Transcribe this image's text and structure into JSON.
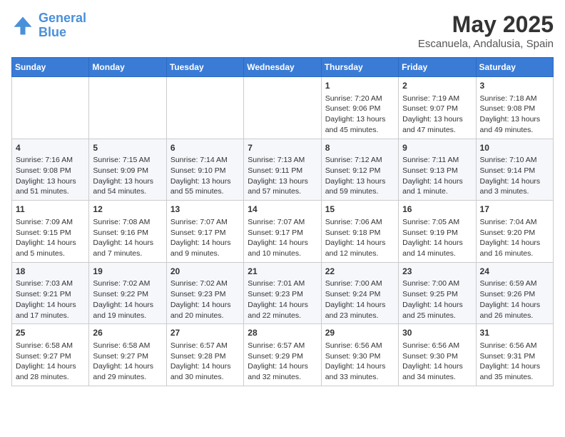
{
  "header": {
    "logo_line1": "General",
    "logo_line2": "Blue",
    "month": "May 2025",
    "location": "Escanuela, Andalusia, Spain"
  },
  "days_of_week": [
    "Sunday",
    "Monday",
    "Tuesday",
    "Wednesday",
    "Thursday",
    "Friday",
    "Saturday"
  ],
  "weeks": [
    [
      {
        "day": "",
        "content": ""
      },
      {
        "day": "",
        "content": ""
      },
      {
        "day": "",
        "content": ""
      },
      {
        "day": "",
        "content": ""
      },
      {
        "day": "1",
        "content": "Sunrise: 7:20 AM\nSunset: 9:06 PM\nDaylight: 13 hours\nand 45 minutes."
      },
      {
        "day": "2",
        "content": "Sunrise: 7:19 AM\nSunset: 9:07 PM\nDaylight: 13 hours\nand 47 minutes."
      },
      {
        "day": "3",
        "content": "Sunrise: 7:18 AM\nSunset: 9:08 PM\nDaylight: 13 hours\nand 49 minutes."
      }
    ],
    [
      {
        "day": "4",
        "content": "Sunrise: 7:16 AM\nSunset: 9:08 PM\nDaylight: 13 hours\nand 51 minutes."
      },
      {
        "day": "5",
        "content": "Sunrise: 7:15 AM\nSunset: 9:09 PM\nDaylight: 13 hours\nand 54 minutes."
      },
      {
        "day": "6",
        "content": "Sunrise: 7:14 AM\nSunset: 9:10 PM\nDaylight: 13 hours\nand 55 minutes."
      },
      {
        "day": "7",
        "content": "Sunrise: 7:13 AM\nSunset: 9:11 PM\nDaylight: 13 hours\nand 57 minutes."
      },
      {
        "day": "8",
        "content": "Sunrise: 7:12 AM\nSunset: 9:12 PM\nDaylight: 13 hours\nand 59 minutes."
      },
      {
        "day": "9",
        "content": "Sunrise: 7:11 AM\nSunset: 9:13 PM\nDaylight: 14 hours\nand 1 minute."
      },
      {
        "day": "10",
        "content": "Sunrise: 7:10 AM\nSunset: 9:14 PM\nDaylight: 14 hours\nand 3 minutes."
      }
    ],
    [
      {
        "day": "11",
        "content": "Sunrise: 7:09 AM\nSunset: 9:15 PM\nDaylight: 14 hours\nand 5 minutes."
      },
      {
        "day": "12",
        "content": "Sunrise: 7:08 AM\nSunset: 9:16 PM\nDaylight: 14 hours\nand 7 minutes."
      },
      {
        "day": "13",
        "content": "Sunrise: 7:07 AM\nSunset: 9:17 PM\nDaylight: 14 hours\nand 9 minutes."
      },
      {
        "day": "14",
        "content": "Sunrise: 7:07 AM\nSunset: 9:17 PM\nDaylight: 14 hours\nand 10 minutes."
      },
      {
        "day": "15",
        "content": "Sunrise: 7:06 AM\nSunset: 9:18 PM\nDaylight: 14 hours\nand 12 minutes."
      },
      {
        "day": "16",
        "content": "Sunrise: 7:05 AM\nSunset: 9:19 PM\nDaylight: 14 hours\nand 14 minutes."
      },
      {
        "day": "17",
        "content": "Sunrise: 7:04 AM\nSunset: 9:20 PM\nDaylight: 14 hours\nand 16 minutes."
      }
    ],
    [
      {
        "day": "18",
        "content": "Sunrise: 7:03 AM\nSunset: 9:21 PM\nDaylight: 14 hours\nand 17 minutes."
      },
      {
        "day": "19",
        "content": "Sunrise: 7:02 AM\nSunset: 9:22 PM\nDaylight: 14 hours\nand 19 minutes."
      },
      {
        "day": "20",
        "content": "Sunrise: 7:02 AM\nSunset: 9:23 PM\nDaylight: 14 hours\nand 20 minutes."
      },
      {
        "day": "21",
        "content": "Sunrise: 7:01 AM\nSunset: 9:23 PM\nDaylight: 14 hours\nand 22 minutes."
      },
      {
        "day": "22",
        "content": "Sunrise: 7:00 AM\nSunset: 9:24 PM\nDaylight: 14 hours\nand 23 minutes."
      },
      {
        "day": "23",
        "content": "Sunrise: 7:00 AM\nSunset: 9:25 PM\nDaylight: 14 hours\nand 25 minutes."
      },
      {
        "day": "24",
        "content": "Sunrise: 6:59 AM\nSunset: 9:26 PM\nDaylight: 14 hours\nand 26 minutes."
      }
    ],
    [
      {
        "day": "25",
        "content": "Sunrise: 6:58 AM\nSunset: 9:27 PM\nDaylight: 14 hours\nand 28 minutes."
      },
      {
        "day": "26",
        "content": "Sunrise: 6:58 AM\nSunset: 9:27 PM\nDaylight: 14 hours\nand 29 minutes."
      },
      {
        "day": "27",
        "content": "Sunrise: 6:57 AM\nSunset: 9:28 PM\nDaylight: 14 hours\nand 30 minutes."
      },
      {
        "day": "28",
        "content": "Sunrise: 6:57 AM\nSunset: 9:29 PM\nDaylight: 14 hours\nand 32 minutes."
      },
      {
        "day": "29",
        "content": "Sunrise: 6:56 AM\nSunset: 9:30 PM\nDaylight: 14 hours\nand 33 minutes."
      },
      {
        "day": "30",
        "content": "Sunrise: 6:56 AM\nSunset: 9:30 PM\nDaylight: 14 hours\nand 34 minutes."
      },
      {
        "day": "31",
        "content": "Sunrise: 6:56 AM\nSunset: 9:31 PM\nDaylight: 14 hours\nand 35 minutes."
      }
    ]
  ]
}
